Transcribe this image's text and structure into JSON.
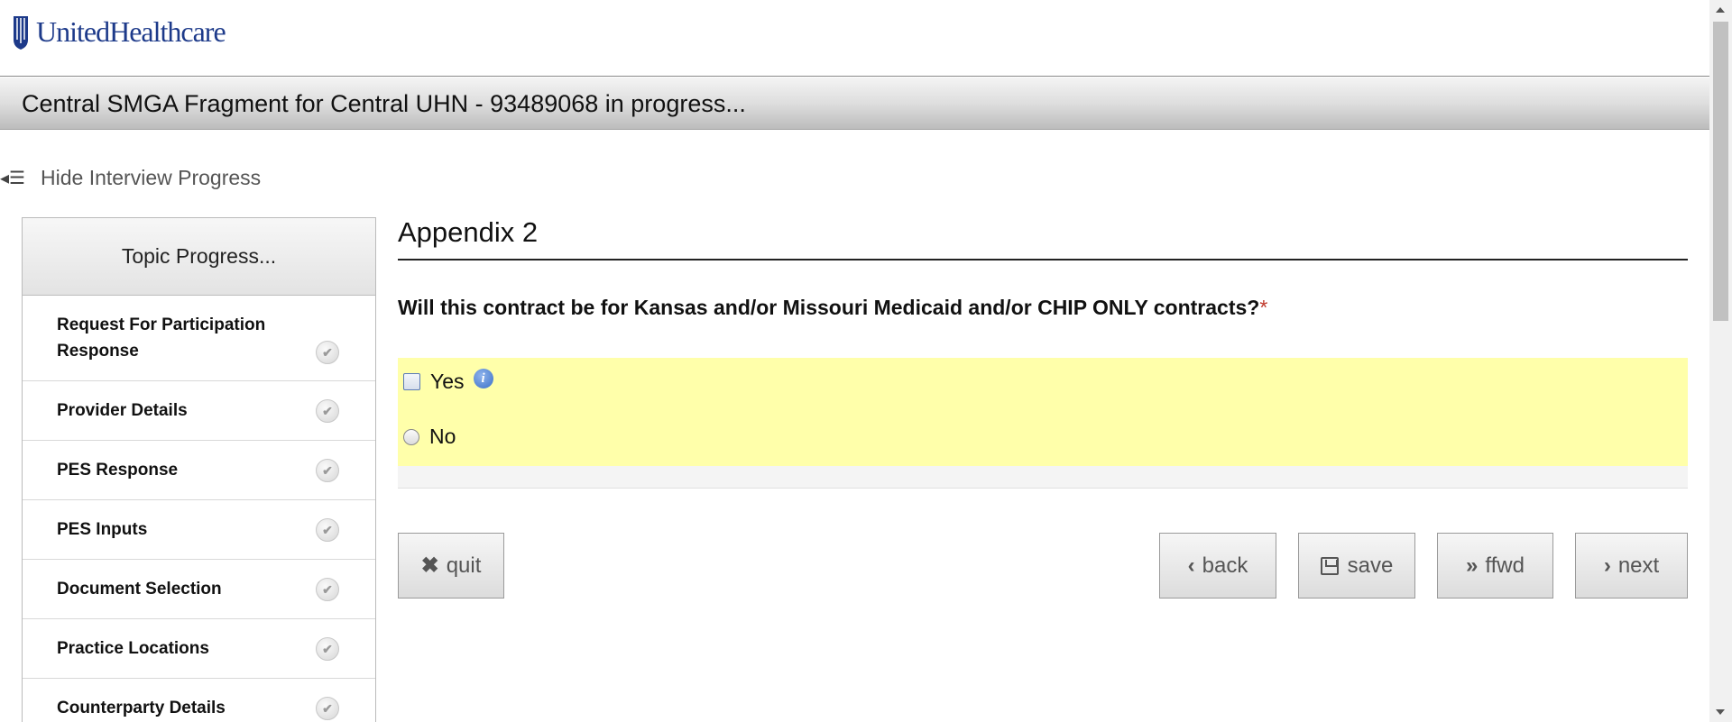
{
  "brand": {
    "name": "UnitedHealthcare",
    "color": "#1d3a8a"
  },
  "title_bar": {
    "text": "Central SMGA Fragment for Central UHN - 93489068 in progress..."
  },
  "progress_toggle": {
    "label": "Hide Interview Progress",
    "icon": "collapse-list-icon"
  },
  "sidebar": {
    "header": "Topic Progress...",
    "topics": [
      {
        "label": "Request For Participation Response",
        "status": "complete"
      },
      {
        "label": "Provider Details",
        "status": "complete"
      },
      {
        "label": "PES Response",
        "status": "complete"
      },
      {
        "label": "PES Inputs",
        "status": "complete"
      },
      {
        "label": "Document Selection",
        "status": "complete"
      },
      {
        "label": "Practice Locations",
        "status": "complete"
      },
      {
        "label": "Counterparty Details",
        "status": "complete"
      }
    ]
  },
  "main": {
    "section_title": "Appendix 2",
    "question": "Will this contract be for Kansas and/or Missouri Medicaid and/or CHIP ONLY contracts?",
    "required_marker": "*",
    "answers": [
      {
        "label": "Yes",
        "selected": false,
        "has_info": true
      },
      {
        "label": "No",
        "selected": false,
        "has_info": false
      }
    ],
    "answer_highlight_color": "#ffffaa"
  },
  "buttons": {
    "quit": "quit",
    "back": "back",
    "save": "save",
    "ffwd": "ffwd",
    "next": "next"
  }
}
